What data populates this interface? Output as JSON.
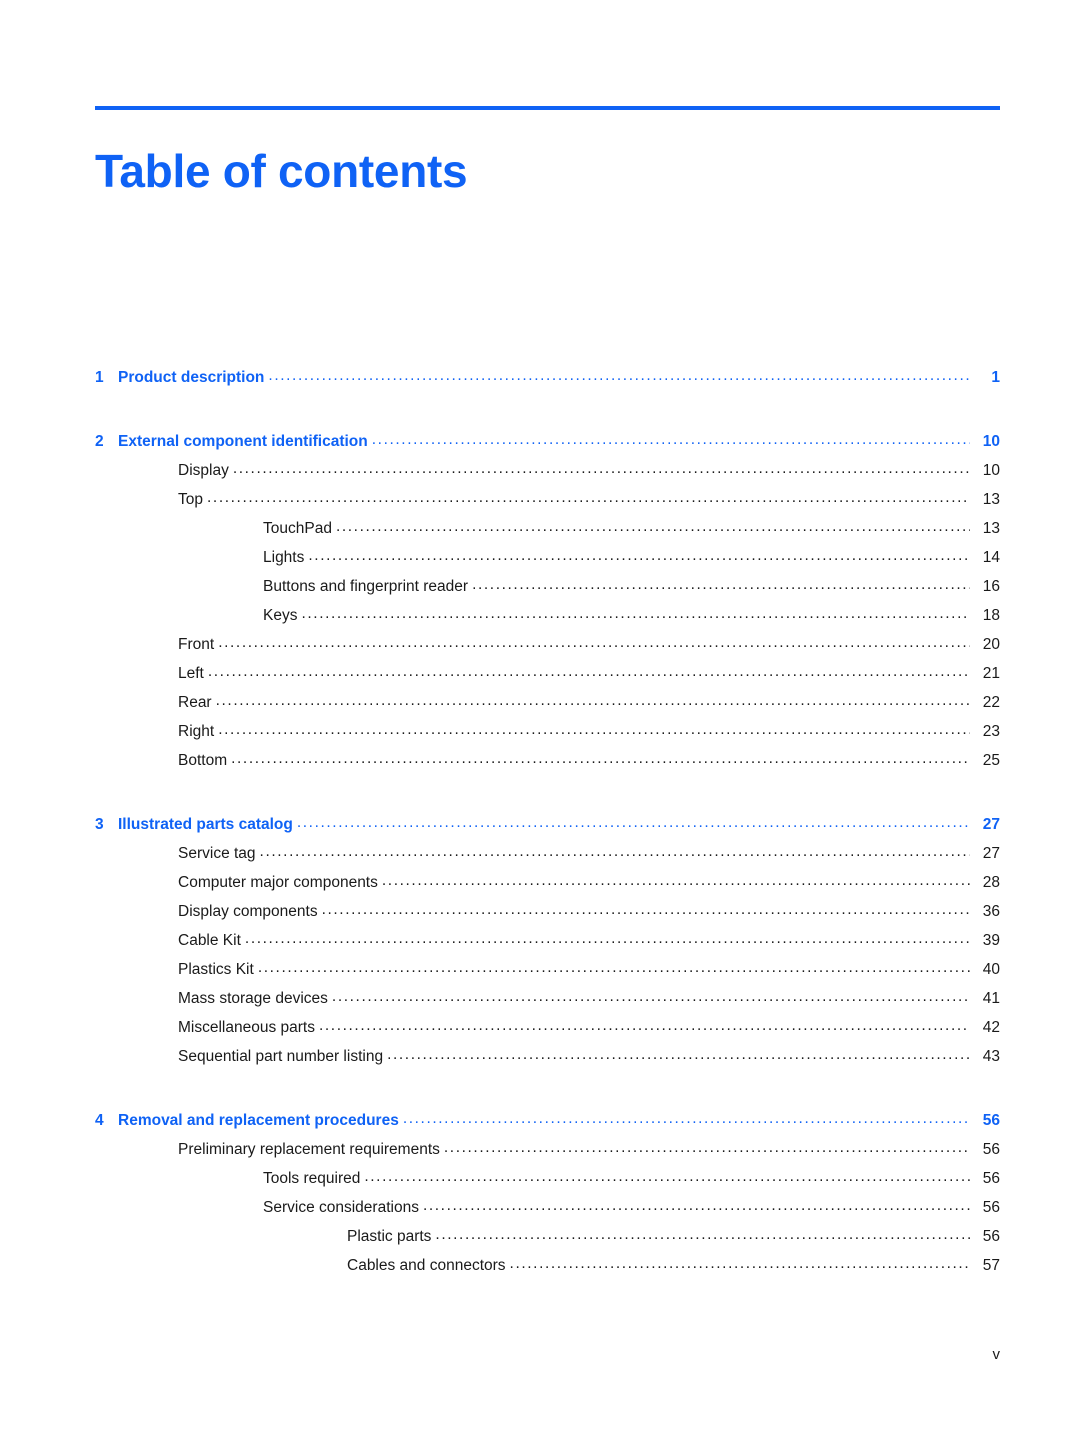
{
  "document": {
    "title": "Table of contents",
    "accent_color": "#0F62F5",
    "body_text_color": "#1a1a1a",
    "leader_char": "."
  },
  "footer": {
    "page_folio": "v"
  },
  "toc": {
    "entries": [
      {
        "level": 1,
        "number": "1",
        "label": "Product description",
        "page": "1"
      },
      {
        "level": 1,
        "number": "2",
        "label": "External component identification",
        "page": "10"
      },
      {
        "level": 2,
        "number": "",
        "label": "Display",
        "page": "10"
      },
      {
        "level": 2,
        "number": "",
        "label": "Top",
        "page": "13"
      },
      {
        "level": 3,
        "number": "",
        "label": "TouchPad",
        "page": "13"
      },
      {
        "level": 3,
        "number": "",
        "label": "Lights",
        "page": "14"
      },
      {
        "level": 3,
        "number": "",
        "label": "Buttons and fingerprint reader",
        "page": "16"
      },
      {
        "level": 3,
        "number": "",
        "label": "Keys",
        "page": "18"
      },
      {
        "level": 2,
        "number": "",
        "label": "Front",
        "page": "20"
      },
      {
        "level": 2,
        "number": "",
        "label": "Left",
        "page": "21"
      },
      {
        "level": 2,
        "number": "",
        "label": "Rear",
        "page": "22"
      },
      {
        "level": 2,
        "number": "",
        "label": "Right",
        "page": "23"
      },
      {
        "level": 2,
        "number": "",
        "label": "Bottom",
        "page": "25"
      },
      {
        "level": 1,
        "number": "3",
        "label": "Illustrated parts catalog",
        "page": "27"
      },
      {
        "level": 2,
        "number": "",
        "label": "Service tag",
        "page": "27"
      },
      {
        "level": 2,
        "number": "",
        "label": "Computer major components",
        "page": "28"
      },
      {
        "level": 2,
        "number": "",
        "label": "Display components",
        "page": "36"
      },
      {
        "level": 2,
        "number": "",
        "label": "Cable Kit",
        "page": "39"
      },
      {
        "level": 2,
        "number": "",
        "label": "Plastics Kit",
        "page": "40"
      },
      {
        "level": 2,
        "number": "",
        "label": "Mass storage devices",
        "page": "41"
      },
      {
        "level": 2,
        "number": "",
        "label": "Miscellaneous parts",
        "page": "42"
      },
      {
        "level": 2,
        "number": "",
        "label": "Sequential part number listing",
        "page": "43"
      },
      {
        "level": 1,
        "number": "4",
        "label": "Removal and replacement procedures",
        "page": "56"
      },
      {
        "level": 2,
        "number": "",
        "label": "Preliminary replacement requirements",
        "page": "56"
      },
      {
        "level": 3,
        "number": "",
        "label": "Tools required",
        "page": "56"
      },
      {
        "level": 3,
        "number": "",
        "label": "Service considerations",
        "page": "56"
      },
      {
        "level": 4,
        "number": "",
        "label": "Plastic parts",
        "page": "56"
      },
      {
        "level": 4,
        "number": "",
        "label": "Cables and connectors",
        "page": "57"
      }
    ]
  }
}
